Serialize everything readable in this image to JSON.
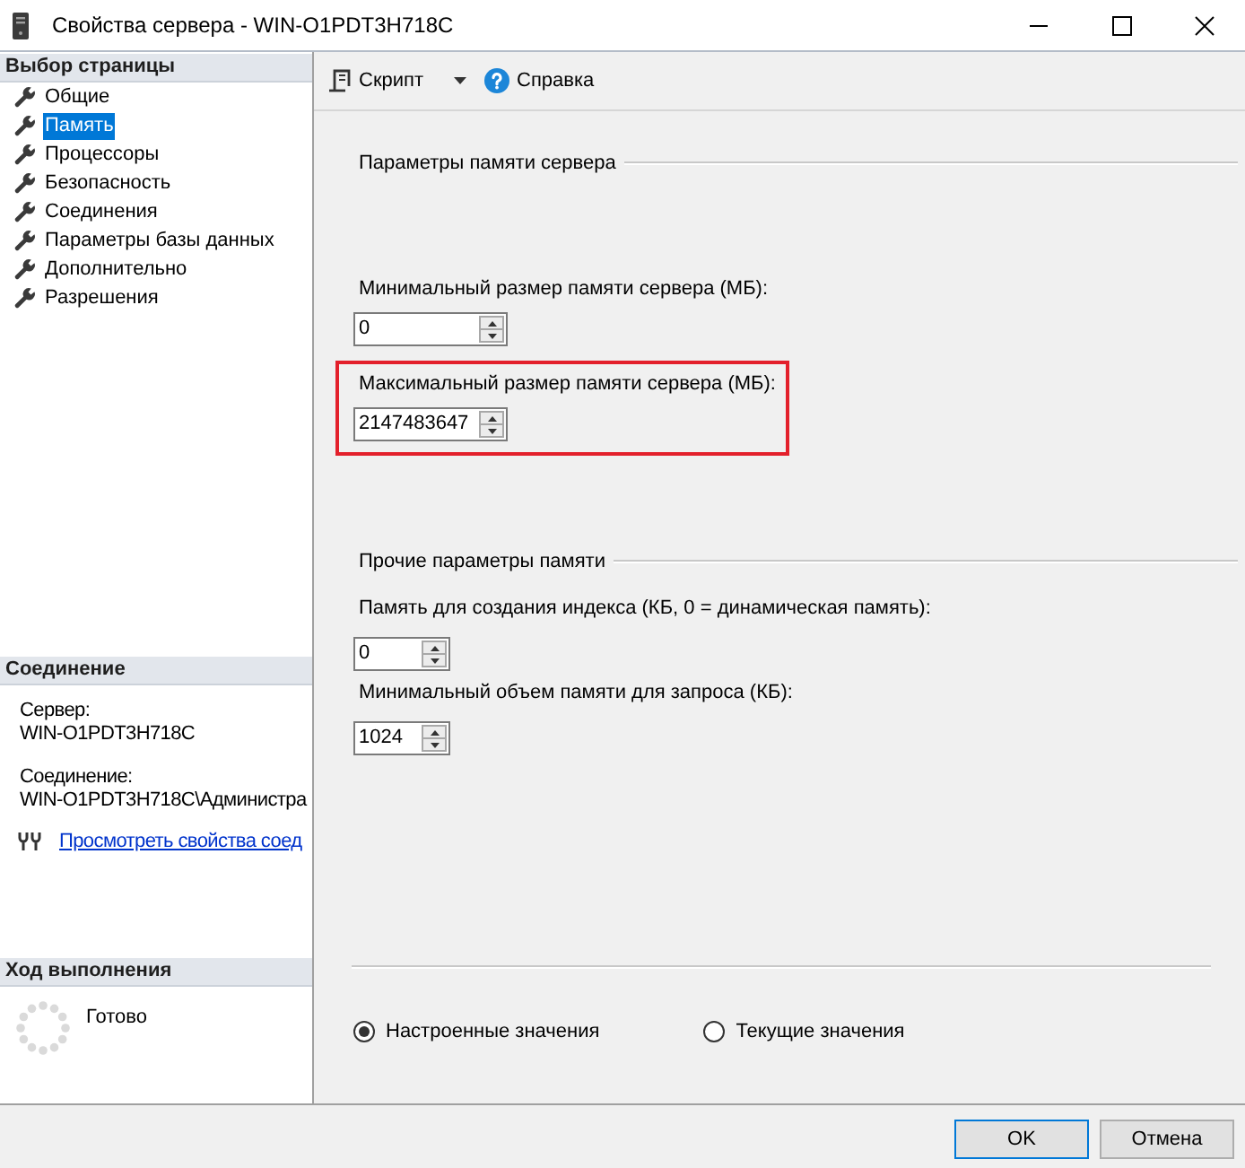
{
  "window": {
    "title": "Свойства сервера - WIN-O1PDT3H718C"
  },
  "sidebar": {
    "page_select": {
      "header": "Выбор страницы",
      "items": [
        {
          "label": "Общие",
          "selected": false
        },
        {
          "label": "Память",
          "selected": true
        },
        {
          "label": "Процессоры",
          "selected": false
        },
        {
          "label": "Безопасность",
          "selected": false
        },
        {
          "label": "Соединения",
          "selected": false
        },
        {
          "label": "Параметры базы данных",
          "selected": false
        },
        {
          "label": "Дополнительно",
          "selected": false
        },
        {
          "label": "Разрешения",
          "selected": false
        }
      ]
    },
    "connection": {
      "header": "Соединение",
      "entries": [
        {
          "label": "Сервер:",
          "value": "WIN-O1PDT3H718C"
        },
        {
          "label": "Соединение:",
          "value": "WIN-O1PDT3H718C\\Администра"
        }
      ],
      "link": "Просмотреть свойства соед"
    },
    "progress": {
      "header": "Ход выполнения",
      "status": "Готово"
    }
  },
  "toolbar": {
    "script_button": {
      "label": "Скрипт"
    },
    "help_button": {
      "label": "Справка"
    }
  },
  "server_memory": {
    "title": "Параметры памяти сервера",
    "fields": [
      {
        "label": "Минимальный размер памяти сервера (МБ):",
        "value": "0",
        "highlighted": false
      },
      {
        "label": "Максимальный размер памяти сервера (МБ):",
        "value": "2147483647",
        "highlighted": true
      }
    ]
  },
  "other_memory": {
    "title": "Прочие параметры памяти",
    "fields": [
      {
        "label": "Память для создания индекса (КБ, 0 = динамическая память):",
        "value": "0"
      },
      {
        "label": "Минимальный объем памяти для запроса (КБ):",
        "value": "1024"
      }
    ]
  },
  "view_mode": {
    "options": [
      {
        "label": "Настроенные значения",
        "selected": true
      },
      {
        "label": "Текущие значения",
        "selected": false
      }
    ]
  },
  "buttons": [
    {
      "label": "OK",
      "default": true
    },
    {
      "label": "Отмена",
      "default": false
    }
  ]
}
